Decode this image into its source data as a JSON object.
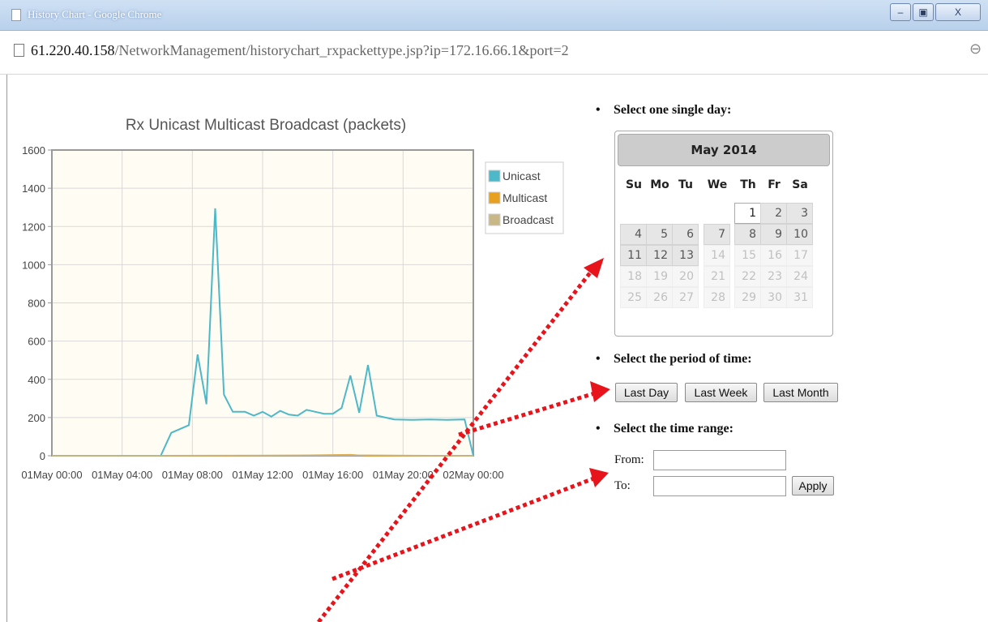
{
  "window": {
    "title": "History Chart - Google Chrome",
    "minimize": "–",
    "maximize": "▣",
    "close": "X"
  },
  "address": {
    "host": "61.220.40.158",
    "path": "/NetworkManagement/historychart_rxpackettype.jsp?ip=172.16.66.1&port=2",
    "zoom_icon": "⊖"
  },
  "chart_data": {
    "type": "line",
    "title": "Rx Unicast Multicast Broadcast (packets)",
    "ylim": [
      0,
      1600
    ],
    "yticks": [
      0,
      200,
      400,
      600,
      800,
      1000,
      1200,
      1400,
      1600
    ],
    "xticks": [
      "01May 00:00",
      "01May 04:00",
      "01May 08:00",
      "01May 12:00",
      "01May 16:00",
      "01May 20:00",
      "02May 00:00"
    ],
    "xlim_hours": [
      0,
      24
    ],
    "grid": true,
    "legend_position": "right",
    "series": [
      {
        "name": "Unicast",
        "color": "#4db8c8",
        "x": [
          0,
          6.2,
          6.8,
          7.8,
          8.3,
          8.8,
          9.3,
          9.8,
          10.3,
          11.0,
          11.5,
          12.0,
          12.5,
          13.0,
          13.5,
          14.0,
          14.5,
          15.0,
          15.5,
          16.0,
          16.5,
          17.0,
          17.5,
          18.0,
          18.5,
          19.5,
          20.5,
          21.5,
          22.5,
          23.5,
          24.0
        ],
        "y": [
          0,
          0,
          120,
          160,
          530,
          270,
          1295,
          320,
          230,
          230,
          210,
          230,
          205,
          235,
          215,
          210,
          240,
          230,
          220,
          220,
          250,
          420,
          225,
          475,
          210,
          190,
          188,
          190,
          188,
          190,
          0
        ]
      },
      {
        "name": "Multicast",
        "color": "#e8a020",
        "x": [
          0,
          10,
          14,
          17,
          18,
          24
        ],
        "y": [
          0,
          0,
          2,
          6,
          0,
          0
        ]
      },
      {
        "name": "Broadcast",
        "color": "#c8b888",
        "x": [
          0,
          12,
          18,
          24
        ],
        "y": [
          0,
          2,
          3,
          0
        ]
      }
    ]
  },
  "calendar": {
    "heading": "Select one single day:",
    "month": "May 2014",
    "weekdays": [
      "Su",
      "Mo",
      "Tu",
      "We",
      "Th",
      "Fr",
      "Sa"
    ],
    "days": [
      "1",
      "2",
      "3",
      "4",
      "5",
      "6",
      "7",
      "8",
      "9",
      "10",
      "11",
      "12",
      "13",
      "14",
      "15",
      "16",
      "17",
      "18",
      "19",
      "20",
      "21",
      "22",
      "23",
      "24",
      "25",
      "26",
      "27",
      "28",
      "29",
      "30",
      "31"
    ]
  },
  "period": {
    "heading": "Select the period of time:",
    "buttons": [
      "Last Day",
      "Last Week",
      "Last Month"
    ]
  },
  "range": {
    "heading": "Select the time range:",
    "from_label": "From:",
    "to_label": "To:",
    "from_value": "",
    "to_value": "",
    "apply": "Apply"
  },
  "colors": {
    "annotation_arrows": "#e8141c",
    "plot_background": "#fffcf3"
  }
}
